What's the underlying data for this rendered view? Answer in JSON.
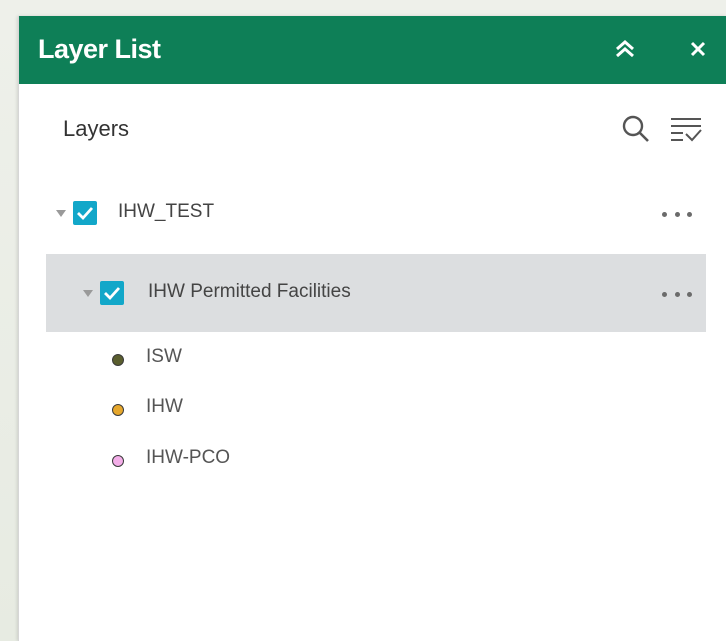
{
  "widget": {
    "title": "Layer List",
    "header_color": "#0e7f57"
  },
  "toolbar": {
    "title": "Layers",
    "search_icon": "search-icon",
    "filter_icon": "filter-list-icon"
  },
  "layers": [
    {
      "label": "IHW_TEST",
      "checked": true,
      "expanded": true,
      "sublayers": [
        {
          "label": "IHW Permitted Facilities",
          "checked": true,
          "expanded": true,
          "legend": [
            {
              "label": "ISW",
              "color": "#5a5e2e"
            },
            {
              "label": "IHW",
              "color": "#e6a72c"
            },
            {
              "label": "IHW-PCO",
              "color": "#f3aee8"
            }
          ]
        }
      ]
    }
  ],
  "colors": {
    "accent": "#0e7f57",
    "checkbox": "#12a7c9",
    "selected_row": "#dcdee0"
  }
}
